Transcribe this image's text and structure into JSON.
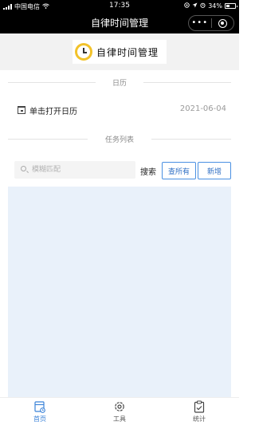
{
  "status_bar": {
    "carrier": "中国电信",
    "time": "17:35",
    "battery": "34%"
  },
  "navbar": {
    "title": "自律时间管理",
    "capsule_more": "•••"
  },
  "banner": {
    "logo_text": "自律时间管理"
  },
  "calendar_section": {
    "divider_label": "日历",
    "open_label": "单击打开日历",
    "date": "2021-06-04"
  },
  "task_section": {
    "divider_label": "任务列表",
    "search_placeholder": "模糊匹配",
    "search_value": "",
    "search_label": "搜索",
    "query_all_label": "查所有",
    "add_label": "新增"
  },
  "tabbar": {
    "items": [
      {
        "label": "首页",
        "icon": "home-calendar-icon",
        "active": true
      },
      {
        "label": "工具",
        "icon": "gear-icon",
        "active": false
      },
      {
        "label": "统计",
        "icon": "clipboard-check-icon",
        "active": false
      }
    ]
  },
  "colors": {
    "accent": "#3a82d8",
    "task_area_bg": "#e9f1fa",
    "logo_yellow": "#f2c22a"
  }
}
